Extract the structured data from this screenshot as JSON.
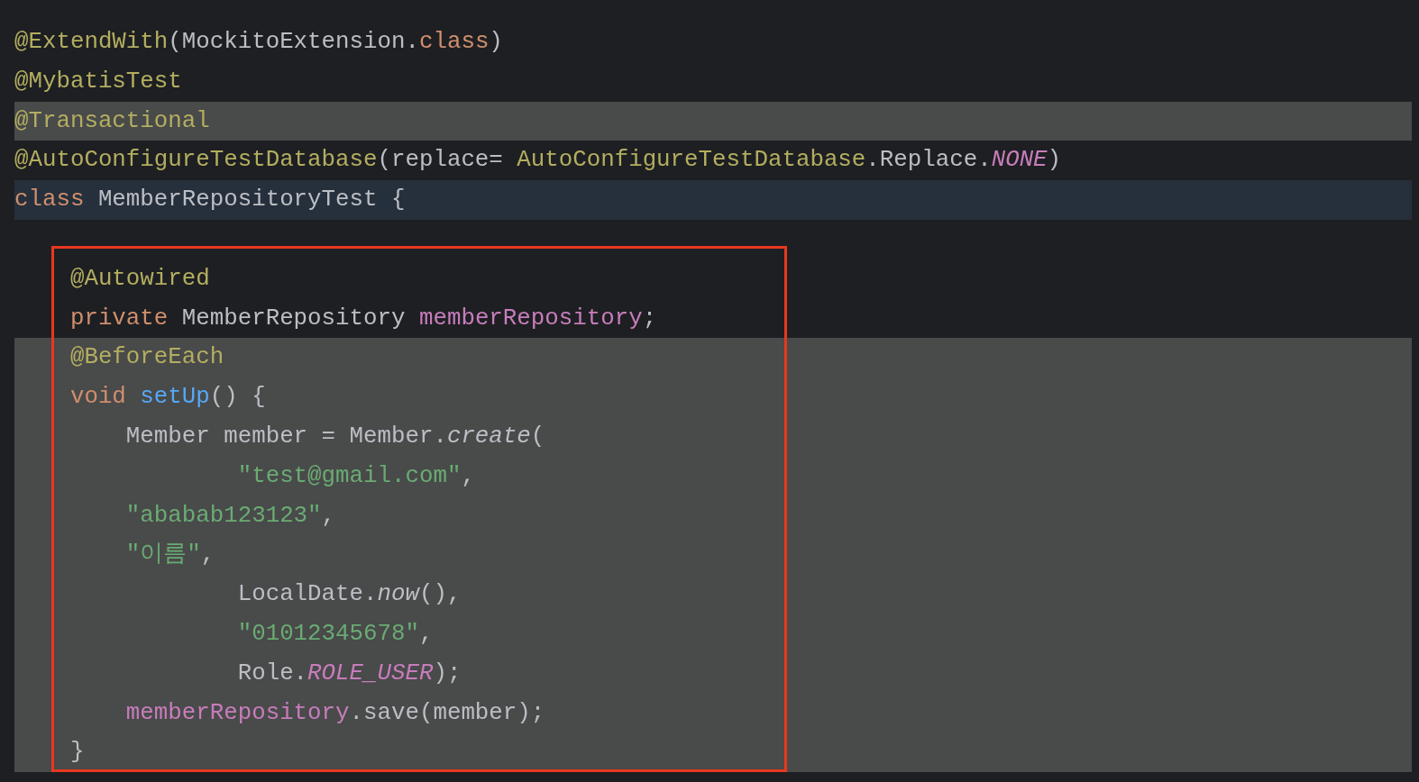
{
  "editor": {
    "lines": [
      {
        "kind": "plain",
        "tokens": [
          {
            "t": "@ExtendWith",
            "kind": "annotation"
          },
          {
            "t": "(MockitoExtension.",
            "kind": "plain"
          },
          {
            "t": "class",
            "kind": "keyword"
          },
          {
            "t": ")",
            "kind": "plain"
          }
        ]
      },
      {
        "kind": "plain",
        "tokens": [
          {
            "t": "@MybatisTest",
            "kind": "annotation"
          }
        ]
      },
      {
        "kind": "selection",
        "tokens": [
          {
            "t": "@Transactional",
            "kind": "annotation"
          }
        ]
      },
      {
        "kind": "plain",
        "tokens": [
          {
            "t": "@AutoConfigureTestDatabase",
            "kind": "annotation"
          },
          {
            "t": "(replace= ",
            "kind": "plain"
          },
          {
            "t": "AutoConfigureTestDatabase",
            "kind": "annotation"
          },
          {
            "t": ".Replace.",
            "kind": "plain"
          },
          {
            "t": "NONE",
            "kind": "constant"
          },
          {
            "t": ")",
            "kind": "plain"
          }
        ]
      },
      {
        "kind": "current",
        "tokens": [
          {
            "t": "class",
            "kind": "keyword"
          },
          {
            "t": " MemberRepositoryTest {",
            "kind": "plain"
          }
        ]
      },
      {
        "kind": "plain"
      },
      {
        "kind": "plain",
        "tokens": [
          {
            "t": "    @Autowired",
            "kind": "annotation"
          }
        ]
      },
      {
        "kind": "plain",
        "tokens": [
          {
            "t": "    private",
            "kind": "keyword"
          },
          {
            "t": " MemberRepository ",
            "kind": "plain"
          },
          {
            "t": "memberRepository",
            "kind": "field"
          },
          {
            "t": ";",
            "kind": "plain"
          }
        ]
      },
      {
        "kind": "selection",
        "tokens": [
          {
            "t": "    @BeforeEach",
            "kind": "annotation"
          }
        ]
      },
      {
        "kind": "selection",
        "tokens": [
          {
            "t": "    void",
            "kind": "keyword"
          },
          {
            "t": " setUp",
            "kind": "method"
          },
          {
            "t": "() {",
            "kind": "plain"
          }
        ]
      },
      {
        "kind": "selection",
        "tokens": [
          {
            "t": "        Member member = Member.",
            "kind": "plain"
          },
          {
            "t": "create",
            "kind": "static-call"
          },
          {
            "t": "(",
            "kind": "plain"
          }
        ]
      },
      {
        "kind": "selection",
        "tokens": [
          {
            "t": "                \"test@gmail.com\"",
            "kind": "string"
          },
          {
            "t": ",",
            "kind": "plain"
          }
        ]
      },
      {
        "kind": "selection",
        "tokens": [
          {
            "t": "        \"ababab123123\"",
            "kind": "string"
          },
          {
            "t": ",",
            "kind": "plain"
          }
        ]
      },
      {
        "kind": "selection",
        "tokens": [
          {
            "t": "        \"이름\"",
            "kind": "string"
          },
          {
            "t": ",",
            "kind": "plain"
          }
        ]
      },
      {
        "kind": "selection",
        "tokens": [
          {
            "t": "                LocalDate.",
            "kind": "plain"
          },
          {
            "t": "now",
            "kind": "static-call"
          },
          {
            "t": "(),",
            "kind": "plain"
          }
        ]
      },
      {
        "kind": "selection",
        "tokens": [
          {
            "t": "                \"01012345678\"",
            "kind": "string"
          },
          {
            "t": ",",
            "kind": "plain"
          }
        ]
      },
      {
        "kind": "selection",
        "tokens": [
          {
            "t": "                Role.",
            "kind": "plain"
          },
          {
            "t": "ROLE_USER",
            "kind": "constant"
          },
          {
            "t": ");",
            "kind": "plain"
          }
        ]
      },
      {
        "kind": "selection",
        "tokens": [
          {
            "t": "        memberRepository",
            "kind": "field"
          },
          {
            "t": ".save(member);",
            "kind": "plain"
          }
        ]
      },
      {
        "kind": "selection",
        "tokens": [
          {
            "t": "    }",
            "kind": "plain"
          }
        ]
      }
    ]
  }
}
